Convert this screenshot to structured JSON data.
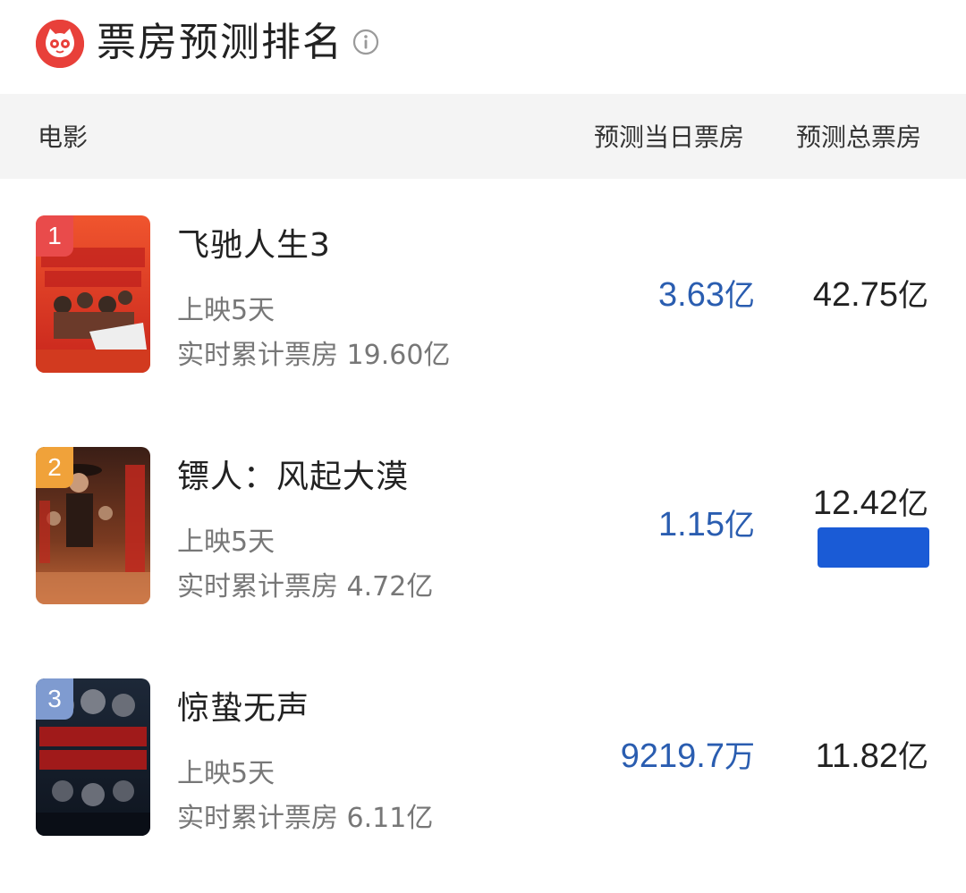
{
  "header": {
    "title": "票房预测排名",
    "logo_icon": "cat-logo-icon",
    "info_icon": "info-icon"
  },
  "columns": {
    "movie": "电影",
    "today": "预测当日票房",
    "total": "预测总票房"
  },
  "colors": {
    "accent": "#2a5db0",
    "brand": "#e8403a",
    "tag": "#1a5bd6"
  },
  "movies": [
    {
      "rank": "1",
      "title": "飞驰人生3",
      "days": "上映5天",
      "cumulative": "实时累计票房 19.60亿",
      "today_number": "3.63",
      "today_unit": "亿",
      "total_number": "42.75",
      "total_unit": "亿",
      "badge_color": "#e94b4b"
    },
    {
      "rank": "2",
      "title": "镖人：风起大漠",
      "days": "上映5天",
      "cumulative": "实时累计票房 4.72亿",
      "today_number": "1.15",
      "today_unit": "亿",
      "total_number": "12.42",
      "total_unit": "亿",
      "badge_color": "#f0a23a"
    },
    {
      "rank": "3",
      "title": "惊蛰无声",
      "days": "上映5天",
      "cumulative": "实时累计票房 6.11亿",
      "today_number": "9219.7",
      "today_unit": "万",
      "total_number": "11.82",
      "total_unit": "亿",
      "badge_color": "#7f9bd0"
    }
  ]
}
